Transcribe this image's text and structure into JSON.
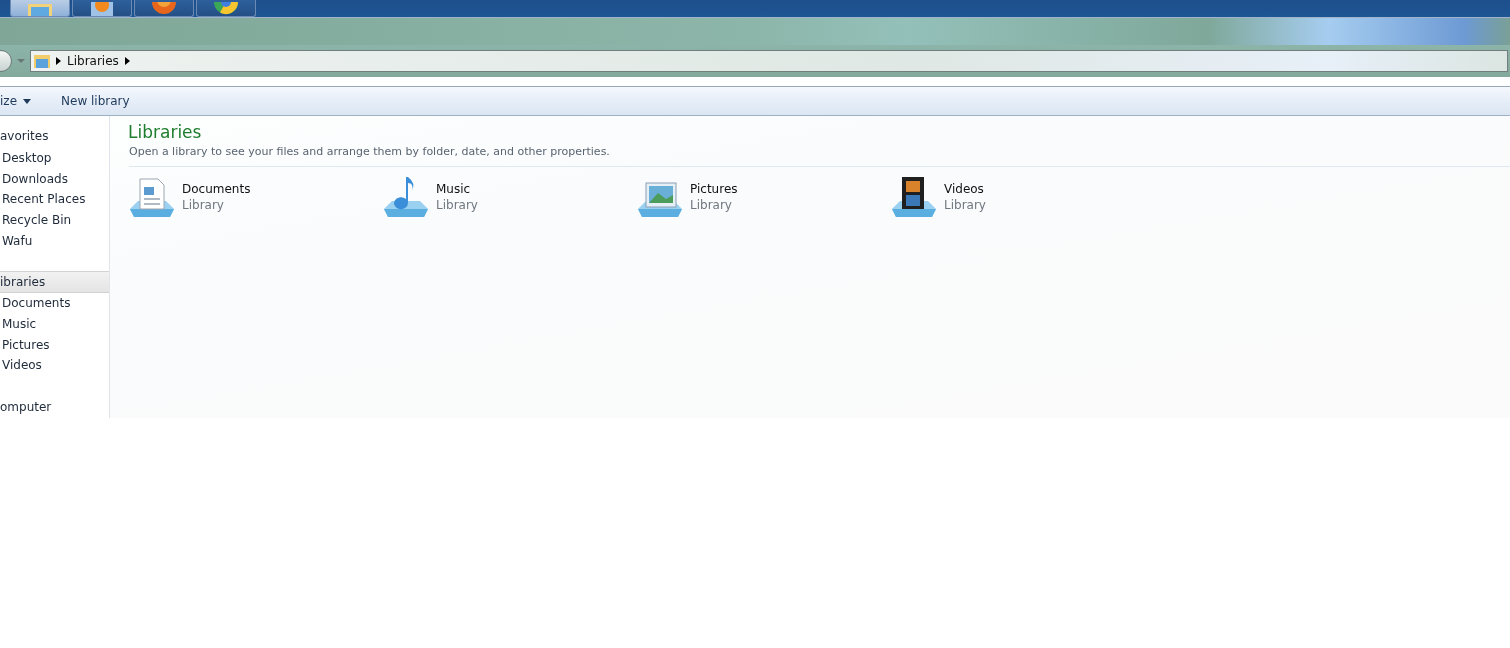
{
  "taskbar": {
    "buttons": [
      {
        "kind": "explorer",
        "selected": true
      },
      {
        "kind": "player",
        "selected": false
      },
      {
        "kind": "firefox",
        "selected": false
      },
      {
        "kind": "chrome",
        "selected": false
      }
    ]
  },
  "address_bar": {
    "crumbs": [
      "Libraries"
    ]
  },
  "toolbar": {
    "items": [
      {
        "kind": "menu",
        "label": "ize"
      },
      {
        "kind": "button",
        "label": "New library"
      }
    ]
  },
  "sidebar": {
    "sections": [
      {
        "header": "avorites",
        "selected": false,
        "items": [
          "Desktop",
          "Downloads",
          "Recent Places",
          "Recycle Bin",
          "Wafu"
        ]
      },
      {
        "header": "ibraries",
        "selected": true,
        "items": [
          "Documents",
          "Music",
          "Pictures",
          "Videos"
        ]
      },
      {
        "header": "omputer",
        "selected": false
      }
    ]
  },
  "main": {
    "title": "Libraries",
    "subtitle": "Open a library to see your files and arrange them by folder, date, and other properties.",
    "libraries": [
      {
        "kind": "documents",
        "name": "Documents",
        "type": "Library"
      },
      {
        "kind": "music",
        "name": "Music",
        "type": "Library"
      },
      {
        "kind": "pictures",
        "name": "Pictures",
        "type": "Library"
      },
      {
        "kind": "videos",
        "name": "Videos",
        "type": "Library"
      }
    ]
  }
}
